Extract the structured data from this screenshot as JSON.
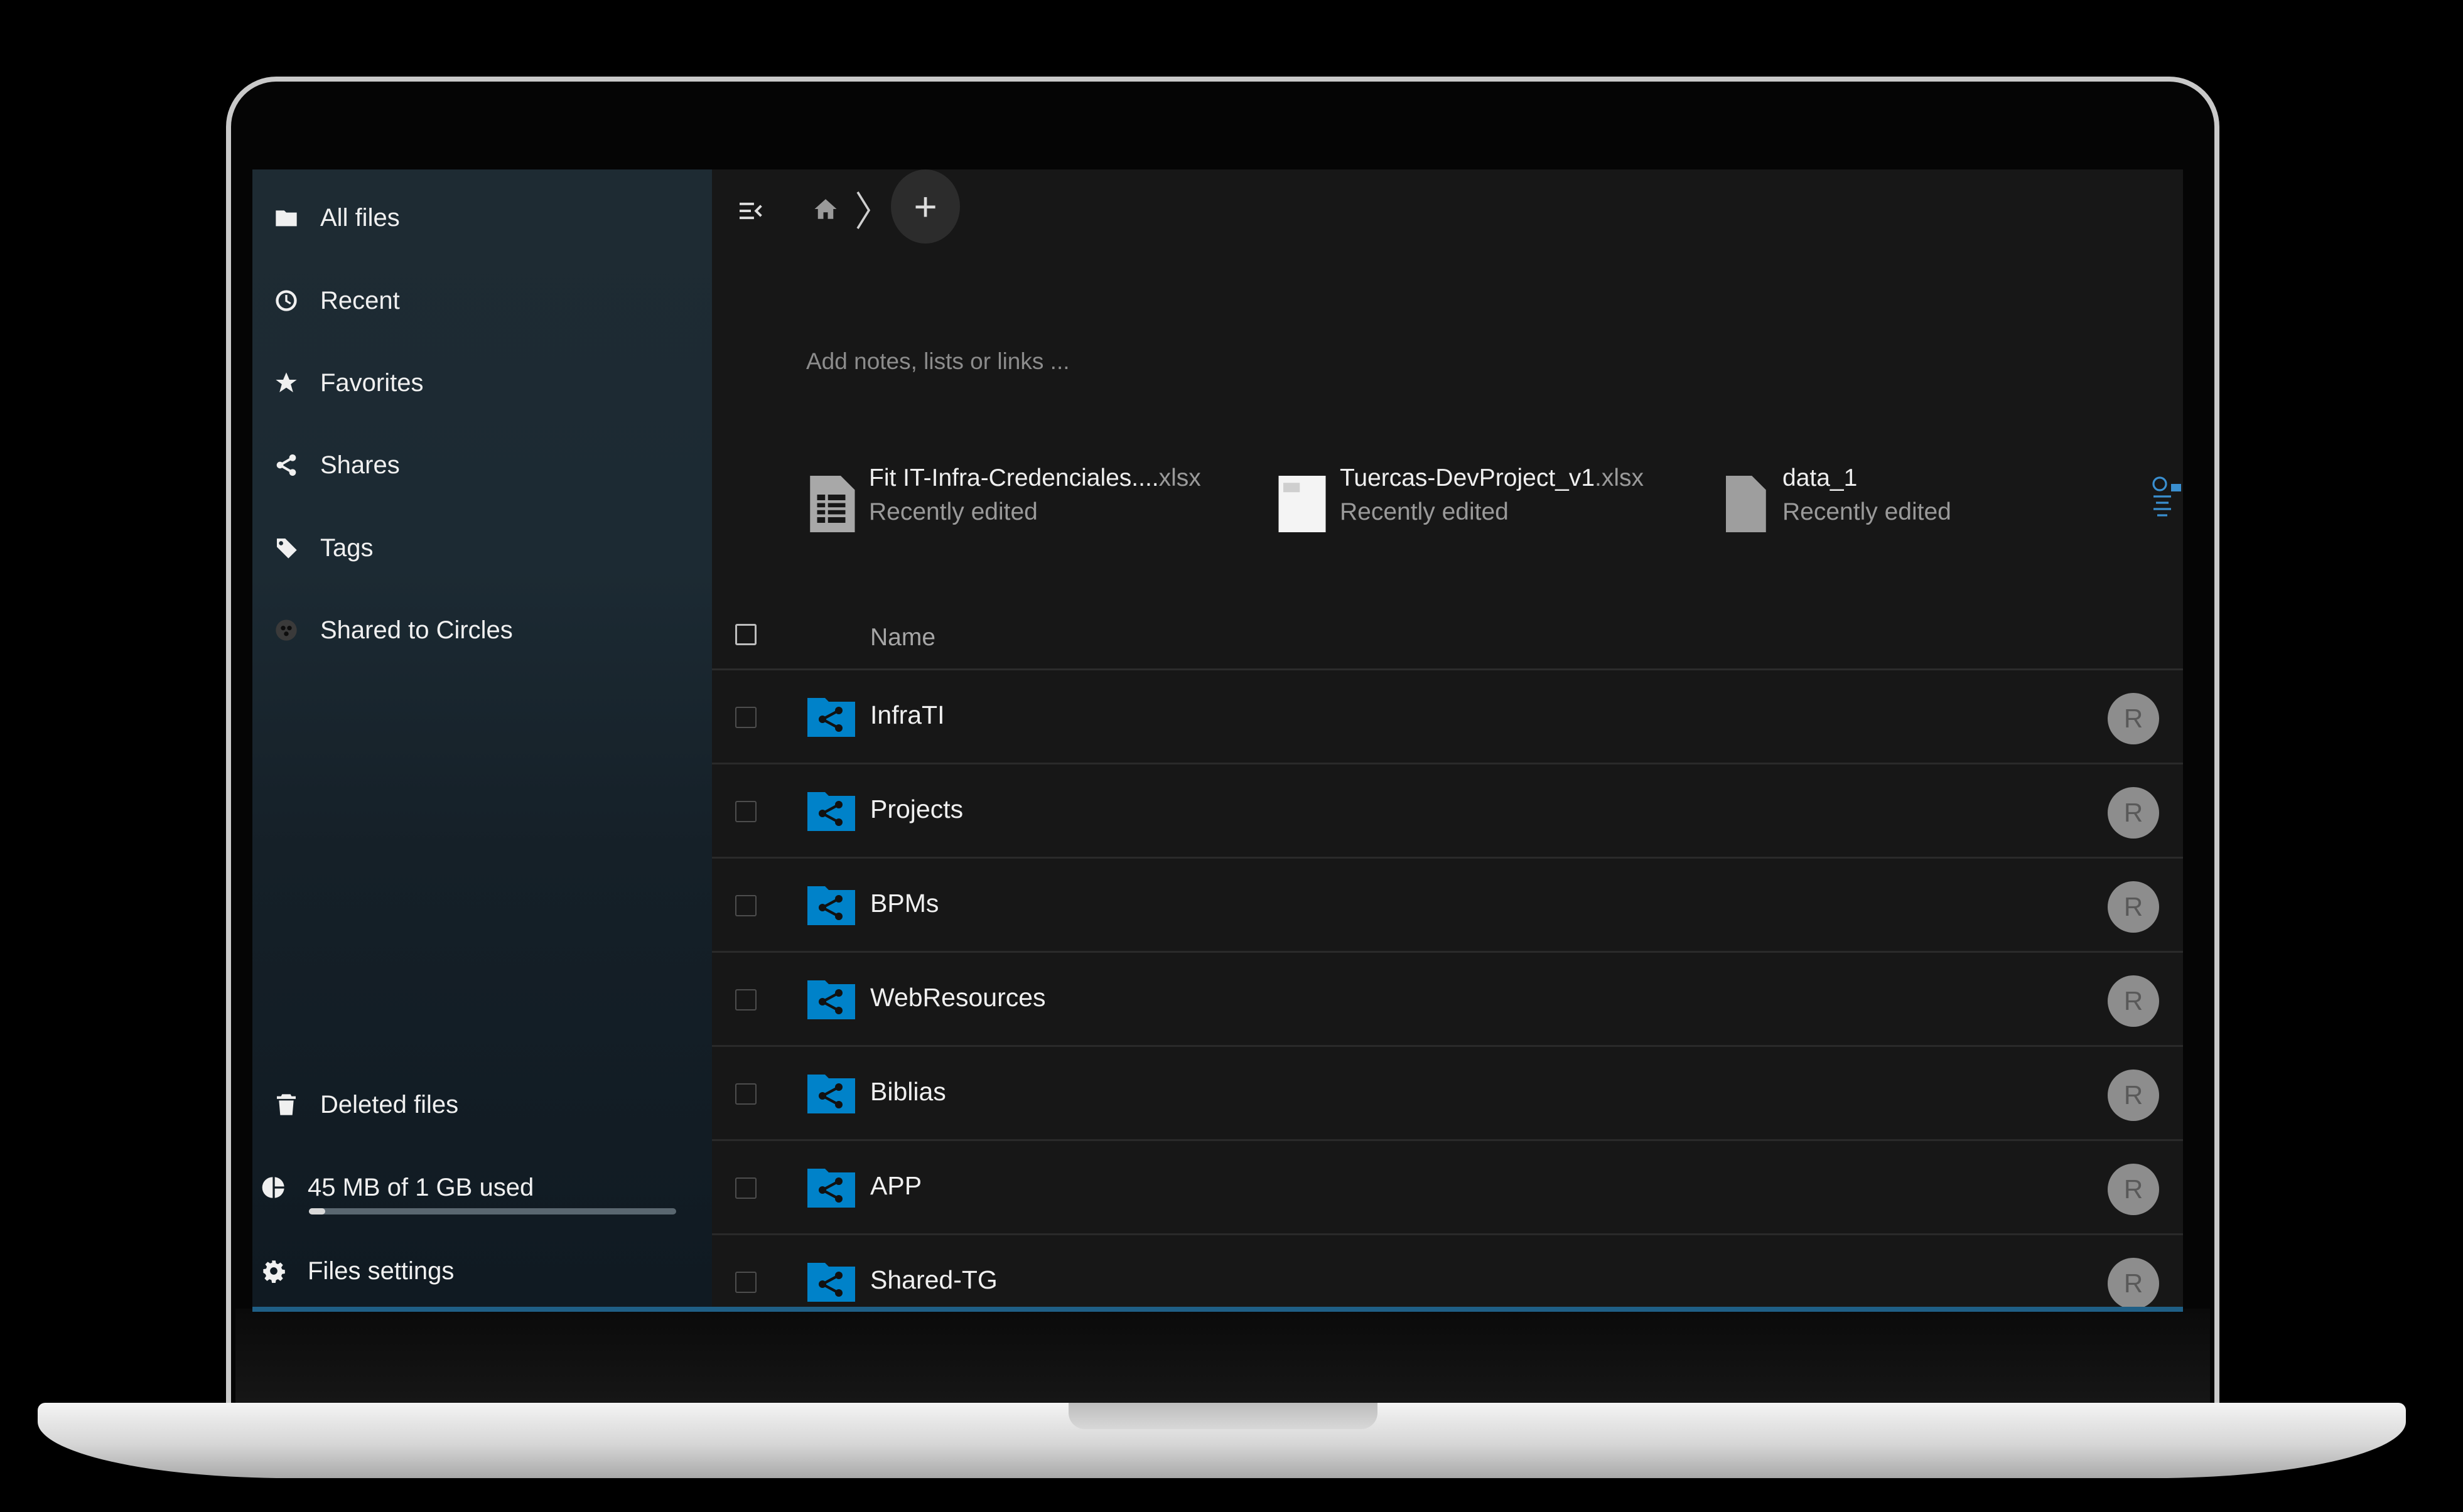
{
  "sidebar": {
    "items": [
      {
        "label": "All files",
        "icon": "folder-icon"
      },
      {
        "label": "Recent",
        "icon": "clock-icon"
      },
      {
        "label": "Favorites",
        "icon": "star-icon"
      },
      {
        "label": "Shares",
        "icon": "share-icon"
      },
      {
        "label": "Tags",
        "icon": "tag-icon"
      },
      {
        "label": "Shared to Circles",
        "icon": "circles-icon"
      }
    ],
    "deleted_label": "Deleted files",
    "quota_label": "45 MB of 1 GB used",
    "quota_fraction": 0.045,
    "settings_label": "Files settings"
  },
  "toolbar": {
    "add_label": "+"
  },
  "notes_placeholder": "Add notes, lists or links ...",
  "recent": [
    {
      "name": "Fit IT-Infra-Credenciales....",
      "ext": "xlsx",
      "status": "Recently edited",
      "icon": "spreadsheet-icon"
    },
    {
      "name": "Tuercas-DevProject_v1",
      "ext": ".xlsx",
      "status": "Recently edited",
      "icon": "spreadsheet-thumbnail"
    },
    {
      "name": "data_1",
      "ext": "",
      "status": "Recently edited",
      "icon": "file-icon"
    }
  ],
  "list": {
    "header_name": "Name",
    "rows": [
      {
        "name": "InfraTI",
        "owner": "R"
      },
      {
        "name": "Projects",
        "owner": "R"
      },
      {
        "name": "BPMs",
        "owner": "R"
      },
      {
        "name": "WebResources",
        "owner": "R"
      },
      {
        "name": "Biblias",
        "owner": "R"
      },
      {
        "name": "APP",
        "owner": "R"
      },
      {
        "name": "Shared-TG",
        "owner": "R"
      }
    ]
  },
  "colors": {
    "accent": "#0082c9",
    "background": "#171717",
    "sidebar": "#1c2a33"
  }
}
